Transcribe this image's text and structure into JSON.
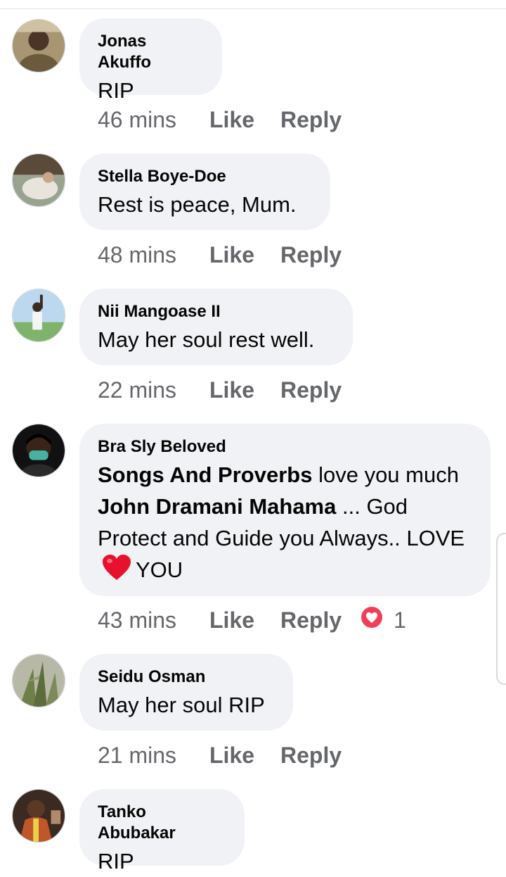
{
  "comments": [
    {
      "author": "Jonas Akuffo",
      "text": "RIP",
      "time": "46 mins",
      "like": "Like",
      "reply": "Reply",
      "avatar_color": "#6b5a3c"
    },
    {
      "author": "Stella Boye-Doe",
      "text": "Rest is peace, Mum.",
      "time": "48 mins",
      "like": "Like",
      "reply": "Reply",
      "avatar_color": "#8a9a84"
    },
    {
      "author": "Nii Mangoase II",
      "text": "May her soul rest well.",
      "time": "22 mins",
      "like": "Like",
      "reply": "Reply",
      "avatar_color": "#7fb36b"
    },
    {
      "author": "Bra Sly Beloved",
      "text_parts": {
        "mention1": "Songs And Proverbs",
        "t1": " love you much",
        "mention2": "John Dramani Mahama",
        "t2": " ... God Protect and Guide you Always.. LOVE",
        "t3": "YOU"
      },
      "time": "43 mins",
      "like": "Like",
      "reply": "Reply",
      "reaction": {
        "icon": "love-reaction-icon",
        "count": "1"
      },
      "avatar_color": "#111111"
    },
    {
      "author": "Seidu Osman",
      "text": "May her soul RIP",
      "time": "21 mins",
      "like": "Like",
      "reply": "Reply",
      "avatar_color": "#7c8a5c"
    },
    {
      "author": "Tanko Abubakar",
      "text": "RIP",
      "avatar_color": "#c0562a"
    }
  ],
  "colors": {
    "bubble": "#f0f2f5",
    "meta": "#65676b",
    "heart": "#f33e58"
  }
}
